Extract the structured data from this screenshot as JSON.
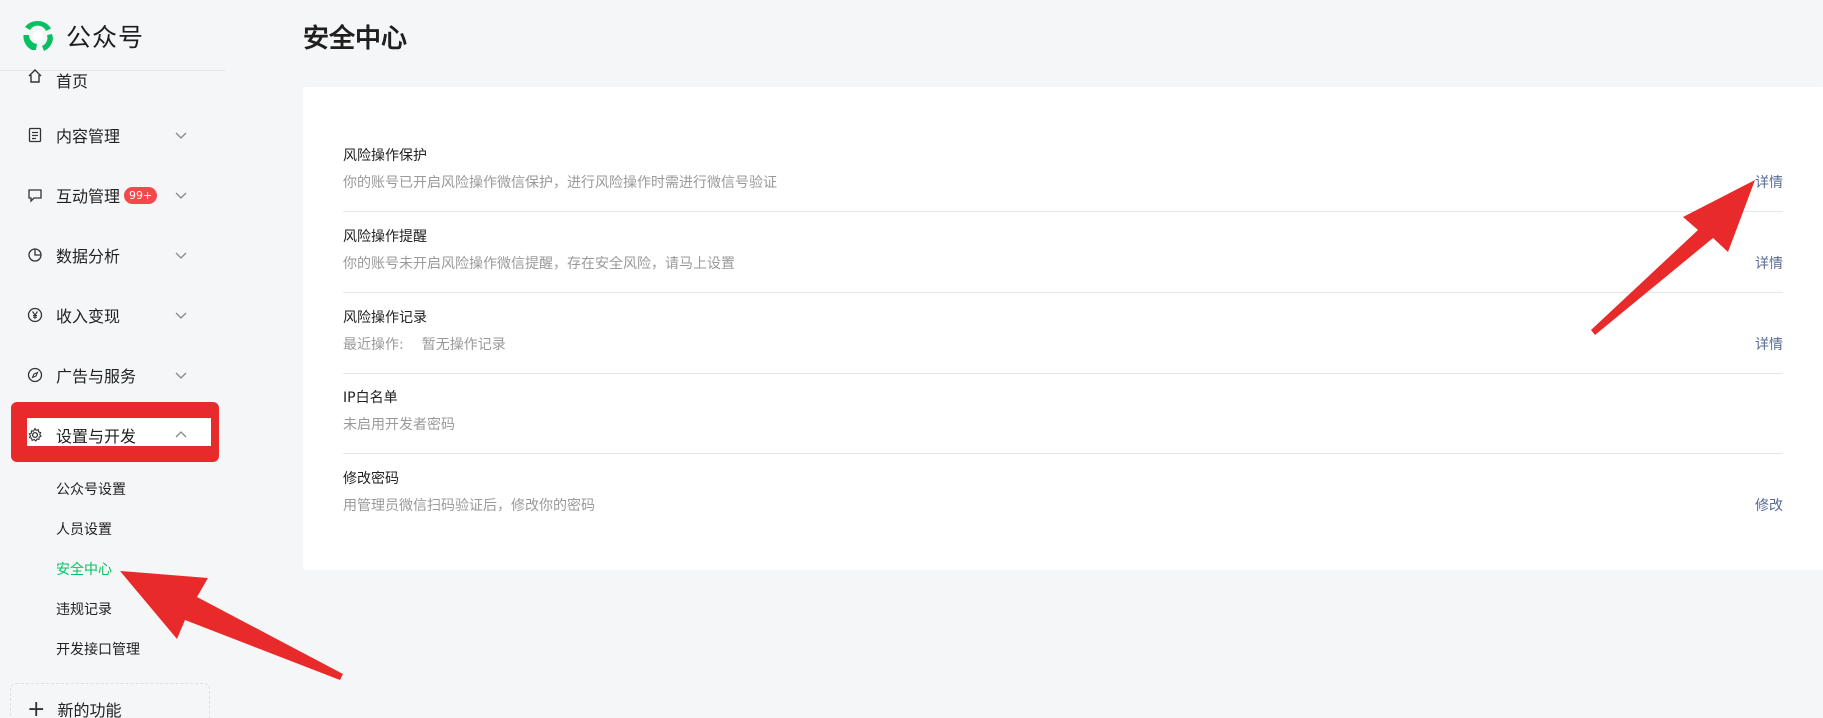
{
  "brand": {
    "name": "公众号",
    "logo_icon": "wechat-official-logo-icon",
    "logo_color": "#07c160"
  },
  "sidebar": {
    "home_label": "首页",
    "items": [
      {
        "label": "内容管理",
        "icon": "document-icon"
      },
      {
        "label": "互动管理",
        "icon": "chat-icon",
        "badge": "99+"
      },
      {
        "label": "数据分析",
        "icon": "pie-chart-icon"
      },
      {
        "label": "收入变现",
        "icon": "yen-icon"
      },
      {
        "label": "广告与服务",
        "icon": "compass-icon"
      },
      {
        "label": "设置与开发",
        "icon": "gear-icon",
        "expanded": true
      }
    ],
    "sub_items": [
      {
        "label": "公众号设置"
      },
      {
        "label": "人员设置"
      },
      {
        "label": "安全中心",
        "active": true
      },
      {
        "label": "违规记录"
      },
      {
        "label": "开发接口管理"
      }
    ],
    "new_feature_label": "新的功能"
  },
  "page": {
    "title": "安全中心",
    "rows": [
      {
        "title": "风险操作保护",
        "desc": "你的账号已开启风险操作微信保护，进行风险操作时需进行微信号验证",
        "action": "详情"
      },
      {
        "title": "风险操作提醒",
        "desc": "你的账号未开启风险操作微信提醒，存在安全风险，请马上设置",
        "action": "详情"
      },
      {
        "title": "风险操作记录",
        "desc_label": "最近操作:",
        "desc_value": "暂无操作记录",
        "action": "详情"
      },
      {
        "title": "IP白名单",
        "desc": "未启用开发者密码"
      },
      {
        "title": "修改密码",
        "desc": "用管理员微信扫码验证后，修改你的密码",
        "action": "修改"
      }
    ]
  },
  "colors": {
    "accent_green": "#07c160",
    "link_blue": "#576b95",
    "annotation_red": "#e82a2a",
    "badge_red": "#f5484a"
  }
}
